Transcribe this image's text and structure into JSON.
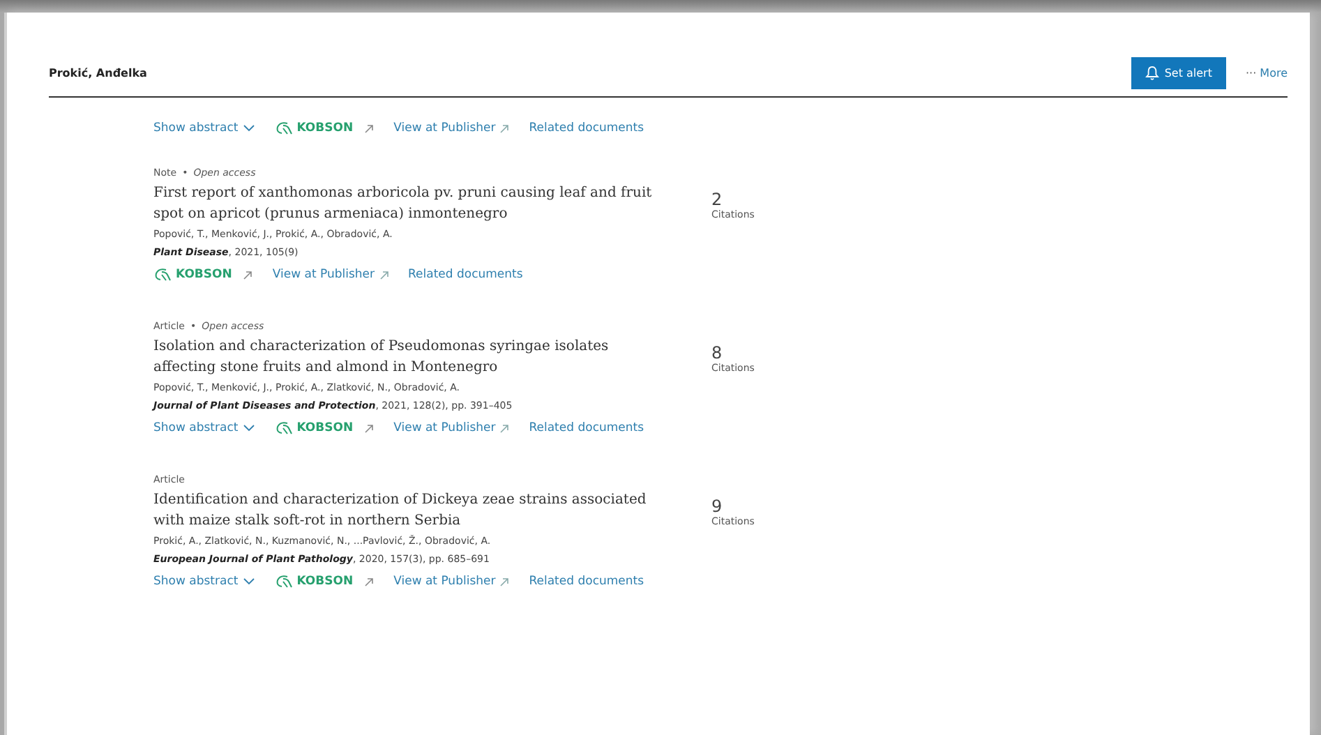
{
  "header": {
    "author": "Prokić, Anđelka",
    "alert_button": "Set alert",
    "more_icon": "···",
    "more_label": "More"
  },
  "documents": [
    {
      "actions": [
        {
          "kind": "abstract",
          "label": "Show abstract"
        },
        {
          "kind": "kobson",
          "label": "KOBSON"
        },
        {
          "kind": "publisher",
          "label": "View at Publisher"
        },
        {
          "kind": "related",
          "label": "Related documents"
        }
      ]
    },
    {
      "doc_type": "Note",
      "separator": "•",
      "access": "Open access",
      "title": "First report of xanthomonas arboricola pv. pruni causing leaf and fruit spot on apricot (prunus armeniaca) inmontenegro",
      "authors": "Popović, T., Menković, J., Prokić, A., Obradović, A.",
      "source": "**Plant Disease**, 2021, 105(9)",
      "citations": "2",
      "citations_label": "Citations",
      "actions": [
        {
          "kind": "kobson",
          "label": "KOBSON"
        },
        {
          "kind": "publisher",
          "label": "View at Publisher"
        },
        {
          "kind": "related",
          "label": "Related documents"
        }
      ]
    },
    {
      "doc_type": "Article",
      "separator": "•",
      "access": "Open access",
      "title": "Isolation and characterization of Pseudomonas syringae isolates affecting stone fruits and almond in Montenegro",
      "authors": "Popović, T., Menković, J., Prokić, A., Zlatković, N., Obradović, A.",
      "source": "**Journal of Plant Diseases and Protection**, 2021, 128(2), pp. 391–405",
      "citations": "8",
      "citations_label": "Citations",
      "actions": [
        {
          "kind": "abstract",
          "label": "Show abstract"
        },
        {
          "kind": "kobson",
          "label": "KOBSON"
        },
        {
          "kind": "publisher",
          "label": "View at Publisher"
        },
        {
          "kind": "related",
          "label": "Related documents"
        }
      ]
    },
    {
      "doc_type": "Article",
      "title": "Identification and characterization of Dickeya zeae strains associated with maize stalk soft-rot in northern Serbia",
      "authors": "Prokić, A., Zlatković, N., Kuzmanović, N., ...Pavlović, Ž., Obradović, A.",
      "source": "**European Journal of Plant Pathology**, 2020, 157(3), pp. 685–691",
      "citations": "9",
      "citations_label": "Citations",
      "actions": [
        {
          "kind": "abstract",
          "label": "Show abstract"
        },
        {
          "kind": "kobson",
          "label": "KOBSON"
        },
        {
          "kind": "publisher",
          "label": "View at Publisher"
        },
        {
          "kind": "related",
          "label": "Related documents"
        }
      ]
    }
  ]
}
